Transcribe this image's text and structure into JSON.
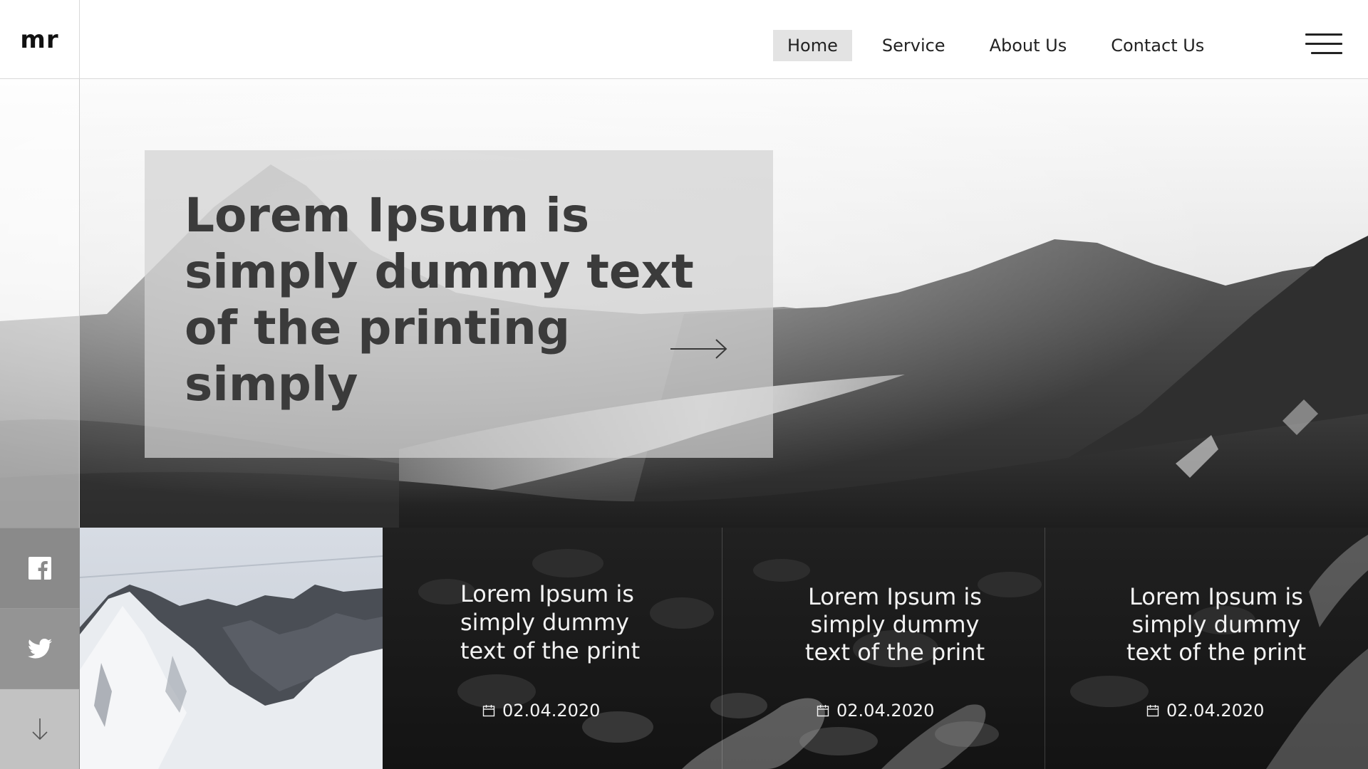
{
  "header": {
    "logo": "mr",
    "nav": [
      {
        "label": "Home",
        "active": true
      },
      {
        "label": "Service",
        "active": false
      },
      {
        "label": "About Us",
        "active": false
      },
      {
        "label": "Contact Us",
        "active": false
      }
    ],
    "menu_icon": "hamburger-icon"
  },
  "hero": {
    "title": "Lorem Ipsum is simply dummy text of the printing simply",
    "cta_icon": "arrow-right-icon"
  },
  "social": [
    {
      "icon": "facebook-icon"
    },
    {
      "icon": "twitter-icon"
    },
    {
      "icon": "arrow-down-icon"
    }
  ],
  "cards": [
    {
      "text": "Lorem Ipsum is simply dummy text of the print",
      "date": "02.04.2020",
      "date_icon": "calendar-icon"
    },
    {
      "text": "Lorem Ipsum is simply dummy text of the print",
      "date": "02.04.2020",
      "date_icon": "calendar-icon"
    },
    {
      "text": "Lorem Ipsum is simply dummy text of the print",
      "date": "02.04.2020",
      "date_icon": "calendar-icon"
    }
  ],
  "colors": {
    "nav_active_bg": "#e3e3e3",
    "text_dark": "#222222",
    "hero_title": "#3b3b3b",
    "card_text": "#f3f3f3"
  }
}
